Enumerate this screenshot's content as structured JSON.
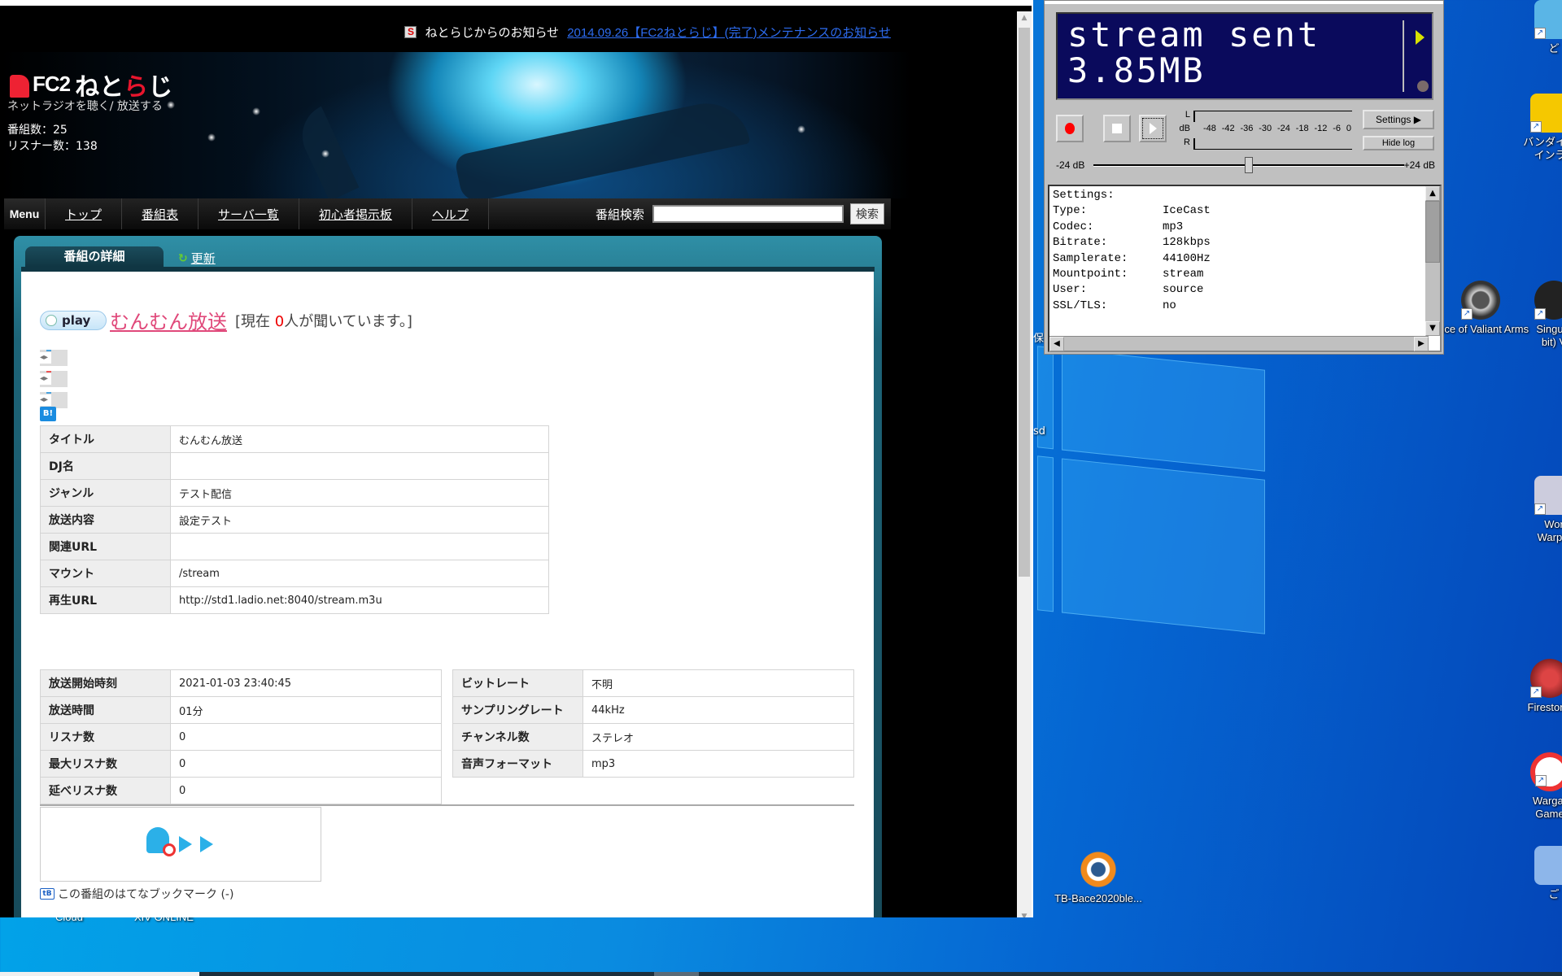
{
  "browser": {
    "notice": {
      "label": "ねとらじからのお知らせ",
      "icon": "netoraji-s-icon",
      "link_text": "2014.09.26【FC2ねとらじ】(完了)メンテナンスのお知らせ"
    },
    "header": {
      "logo_fc2": "FC2",
      "logo_netoraji_prefix": "ねと",
      "logo_netoraji_red": "ら",
      "logo_netoraji_suffix": "じ",
      "tagline": "ネットラジオを聴く/ 放送する",
      "program_count": "番組数：25",
      "listener_count": "リスナー数：138"
    },
    "menu": {
      "label": "Menu",
      "items": [
        {
          "label": "トップ"
        },
        {
          "label": "番組表"
        },
        {
          "label": "サーバ一覧"
        },
        {
          "label": "初心者掲示板"
        },
        {
          "label": "ヘルプ"
        }
      ],
      "search_label": "番組検索",
      "search_value": "",
      "search_button": "検索"
    },
    "tabs": {
      "active": "番組の詳細",
      "refresh": "更新"
    },
    "program": {
      "play_label": "play",
      "title": "むんむん放送",
      "listening_prefix": "[現在 ",
      "listening_count": "0",
      "listening_suffix": "人が聞いています。]",
      "hatena_badge": "B!"
    },
    "details": [
      {
        "key": "タイトル",
        "value": "むんむん放送"
      },
      {
        "key": "DJ名",
        "value": ""
      },
      {
        "key": "ジャンル",
        "value": "テスト配信"
      },
      {
        "key": "放送内容",
        "value": "設定テスト"
      },
      {
        "key": "関連URL",
        "value": ""
      },
      {
        "key": "マウント",
        "value": "/stream"
      },
      {
        "key": "再生URL",
        "value": "http://std1.ladio.net:8040/stream.m3u"
      }
    ],
    "stats_left": [
      {
        "key": "放送開始時刻",
        "value": "2021-01-03 23:40:45"
      },
      {
        "key": "放送時間",
        "value": "01分"
      },
      {
        "key": "リスナ数",
        "value": "0"
      },
      {
        "key": "最大リスナ数",
        "value": "0"
      },
      {
        "key": "延べリスナ数",
        "value": "0"
      }
    ],
    "stats_right": [
      {
        "key": "ビットレート",
        "value": "不明"
      },
      {
        "key": "サンプリングレート",
        "value": "44kHz"
      },
      {
        "key": "チャンネル数",
        "value": "ステレオ"
      },
      {
        "key": "音声フォーマット",
        "value": "mp3"
      }
    ],
    "hatena_bookmark": {
      "icon_label": "tB",
      "text": "この番組のはてなブックマーク (-)"
    }
  },
  "stream_app": {
    "lcd_line1": "stream sent",
    "lcd_line2": "3.85MB",
    "meter": {
      "left_label": "L",
      "db_label": "dB",
      "right_label": "R",
      "scale": [
        "-48",
        "-42",
        "-36",
        "-30",
        "-24",
        "-18",
        "-12",
        "-6",
        "0"
      ]
    },
    "settings_button": "Settings",
    "hide_log_button": "Hide log",
    "gain": {
      "min_label": "-24 dB",
      "max_label": "+24 dB",
      "value_db": 0
    },
    "log": [
      {
        "key": "Settings:",
        "value": ""
      },
      {
        "key": "Type:",
        "value": "IceCast"
      },
      {
        "key": "Codec:",
        "value": "mp3"
      },
      {
        "key": "Bitrate:",
        "value": "128kbps"
      },
      {
        "key": "Samplerate:",
        "value": "44100Hz"
      },
      {
        "key": "Mountpoint:",
        "value": "stream"
      },
      {
        "key": "User:",
        "value": "source"
      },
      {
        "key": "SSL/TLS:",
        "value": "no"
      }
    ]
  },
  "desktop": {
    "icons": [
      {
        "label": "ど",
        "name": "desktop-icon-dokata"
      },
      {
        "label": "バンダイナ インラ",
        "name": "desktop-icon-bandai-namco"
      },
      {
        "label": "ance of Valiant Arms",
        "name": "desktop-icon-alliance-of-valiant-arms"
      },
      {
        "label": "Singula bit) V",
        "name": "desktop-icon-singularity"
      },
      {
        "label": "Wor Warpla",
        "name": "desktop-icon-world-of-warplanes"
      },
      {
        "label": "Firestorm",
        "name": "desktop-icon-firestorm"
      },
      {
        "label": "Wargar Game",
        "name": "desktop-icon-wargaming"
      },
      {
        "label": "ご",
        "name": "desktop-icon-recycle-bin"
      },
      {
        "label": "TB-Bace2020ble...",
        "name": "desktop-icon-blender-file"
      }
    ],
    "partial_labels": [
      "保",
      "sd"
    ],
    "below_labels": [
      "Cloud",
      "XIV ONLINE"
    ]
  }
}
